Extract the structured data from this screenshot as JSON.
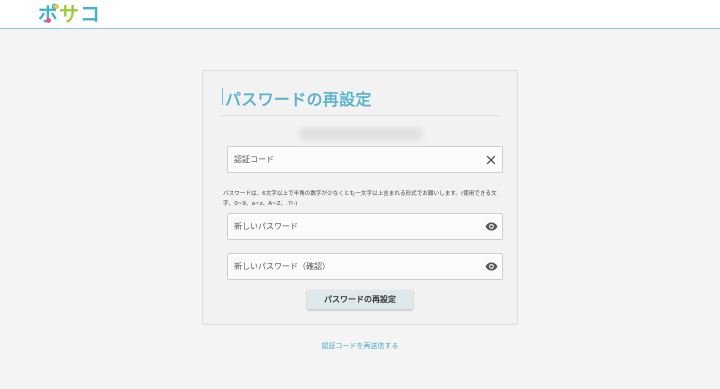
{
  "brand": {
    "logo_text": "ポサコ",
    "colors": {
      "teal": "#3fb3c8",
      "lime": "#9bcb3c",
      "pink": "#e8548a",
      "yellow": "#f2c33a"
    }
  },
  "card": {
    "title": "パスワードの再設定",
    "masked_email": "",
    "code_field": {
      "placeholder": "認証コード",
      "value": "",
      "clear_icon": "close-icon"
    },
    "helper_text": "パスワードは、6文字以上で半角の数字が少なくとも一文字以上含まれる形式でお願いします。(使用できる文字、0~9、a~z、A~Z、.?!-)",
    "password_field": {
      "placeholder": "新しいパスワード",
      "value": "",
      "toggle_icon": "eye-icon"
    },
    "password_confirm_field": {
      "placeholder": "新しいパスワード（確認）",
      "value": "",
      "toggle_icon": "eye-icon"
    },
    "submit_label": "パスワードの再設定"
  },
  "resend_link": "認証コードを再送信する",
  "accent_color": "#5cb3cc"
}
